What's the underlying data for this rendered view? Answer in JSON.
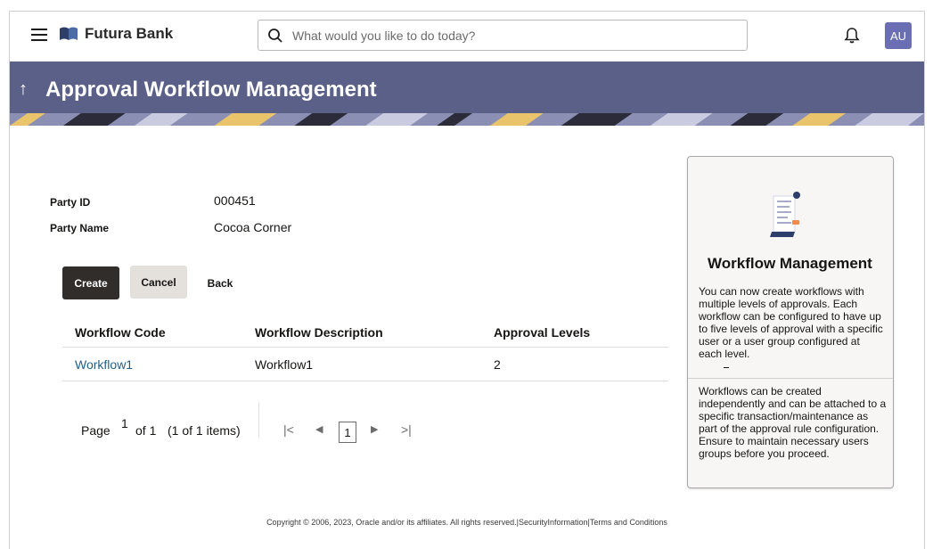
{
  "header": {
    "brand": "Futura Bank",
    "search_placeholder": "What would you like to do today?",
    "avatar_initials": "AU"
  },
  "banner": {
    "title": "Approval Workflow Management"
  },
  "party": {
    "id_label": "Party ID",
    "id_value": "000451",
    "name_label": "Party Name",
    "name_value": "Cocoa Corner"
  },
  "actions": {
    "create": "Create",
    "cancel": "Cancel",
    "back": "Back"
  },
  "table": {
    "columns": [
      "Workflow Code",
      "Workflow Description",
      "Approval Levels"
    ],
    "rows": [
      {
        "code": "Workflow1",
        "description": "Workflow1",
        "levels": "2"
      }
    ]
  },
  "pagination": {
    "page_label": "Page",
    "page_number": "1",
    "of_pages": "of 1",
    "items_summary": "(1 of 1 items)",
    "current": "1"
  },
  "info_panel": {
    "title": "Workflow Management",
    "paragraph1": "You can now create workflows with multiple levels of approvals. Each workflow can be configured to have up to five levels of approval with a specific user or a user group configured at each level.",
    "paragraph2": "Workflows can be created independently and can be attached to a specific transaction/maintenance as part of the approval rule configuration. Ensure to maintain necessary users groups before you proceed."
  },
  "footer": {
    "copyright": "Copyright © 2006, 2023, Oracle and/or its affiliates. All rights reserved.|SecurityInformation|Terms and Conditions"
  },
  "colors": {
    "banner": "#5b6088",
    "primary_button": "#312d2a",
    "link": "#1f5f8b",
    "avatar": "#6a6fb4"
  }
}
